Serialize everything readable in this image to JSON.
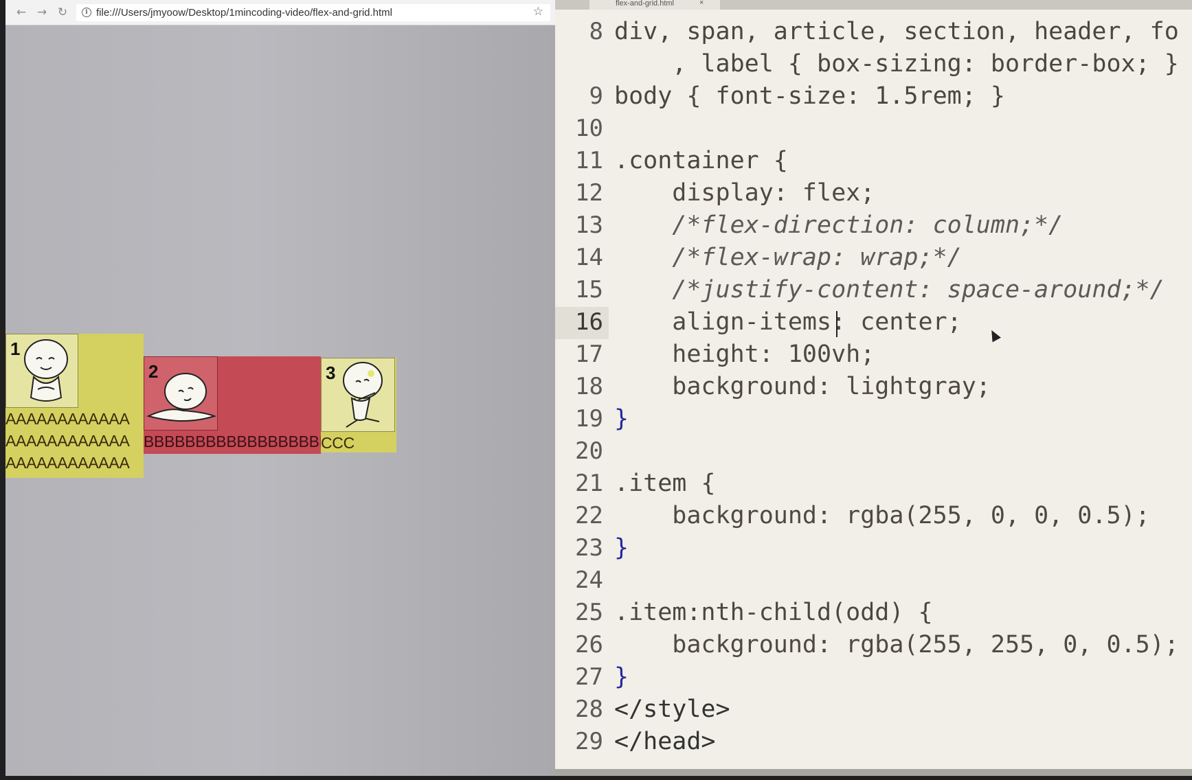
{
  "browser": {
    "nav": {
      "back_icon": "arrow-left-icon",
      "forward_icon": "arrow-right-icon",
      "reload_icon": "reload-icon"
    },
    "url": "file:///Users/jmyoow/Desktop/1mincoding-video/flex-and-grid.html",
    "info_icon": "i",
    "star_icon": "☆"
  },
  "demo": {
    "items": [
      {
        "number": "1",
        "lines": [
          "AAAAAAAAAAAA",
          "AAAAAAAAAAAA",
          "AAAAAAAAAAAA"
        ],
        "color": "yellow"
      },
      {
        "number": "2",
        "lines": [
          "BBBBBBBBBBBBBBBBBBB"
        ],
        "color": "red"
      },
      {
        "number": "3",
        "lines": [
          "CCC"
        ],
        "color": "yellow"
      }
    ]
  },
  "editor": {
    "tab_label": "flex-and-grid.html",
    "tab_close": "×",
    "lines": [
      {
        "num": "8",
        "text": "div, span, article, section, header, fo"
      },
      {
        "num": "",
        "text": "    , label { box-sizing: border-box; }"
      },
      {
        "num": "9",
        "text": "body { font-size: 1.5rem; }"
      },
      {
        "num": "10",
        "text": ""
      },
      {
        "num": "11",
        "text": ".container {"
      },
      {
        "num": "12",
        "text": "    display: flex;"
      },
      {
        "num": "13",
        "text": "    /*flex-direction: column;*/"
      },
      {
        "num": "14",
        "text": "    /*flex-wrap: wrap;*/"
      },
      {
        "num": "15",
        "text": "    /*justify-content: space-around;*/"
      },
      {
        "num": "16",
        "text": "    align-items: center;"
      },
      {
        "num": "17",
        "text": "    height: 100vh;"
      },
      {
        "num": "18",
        "text": "    background: lightgray;"
      },
      {
        "num": "19",
        "text": "}"
      },
      {
        "num": "20",
        "text": ""
      },
      {
        "num": "21",
        "text": ".item {"
      },
      {
        "num": "22",
        "text": "    background: rgba(255, 0, 0, 0.5);"
      },
      {
        "num": "23",
        "text": "}"
      },
      {
        "num": "24",
        "text": ""
      },
      {
        "num": "25",
        "text": ".item:nth-child(odd) {"
      },
      {
        "num": "26",
        "text": "    background: rgba(255, 255, 0, 0.5);"
      },
      {
        "num": "27",
        "text": "}"
      },
      {
        "num": "28",
        "text": "</style>"
      },
      {
        "num": "29",
        "text": "</head>"
      }
    ],
    "active_line": "16"
  },
  "colors": {
    "item_yellow": "#d4d160",
    "item_red": "#c44a55",
    "editor_bg": "#f1efe8",
    "code_value": "#1f1f8f"
  }
}
